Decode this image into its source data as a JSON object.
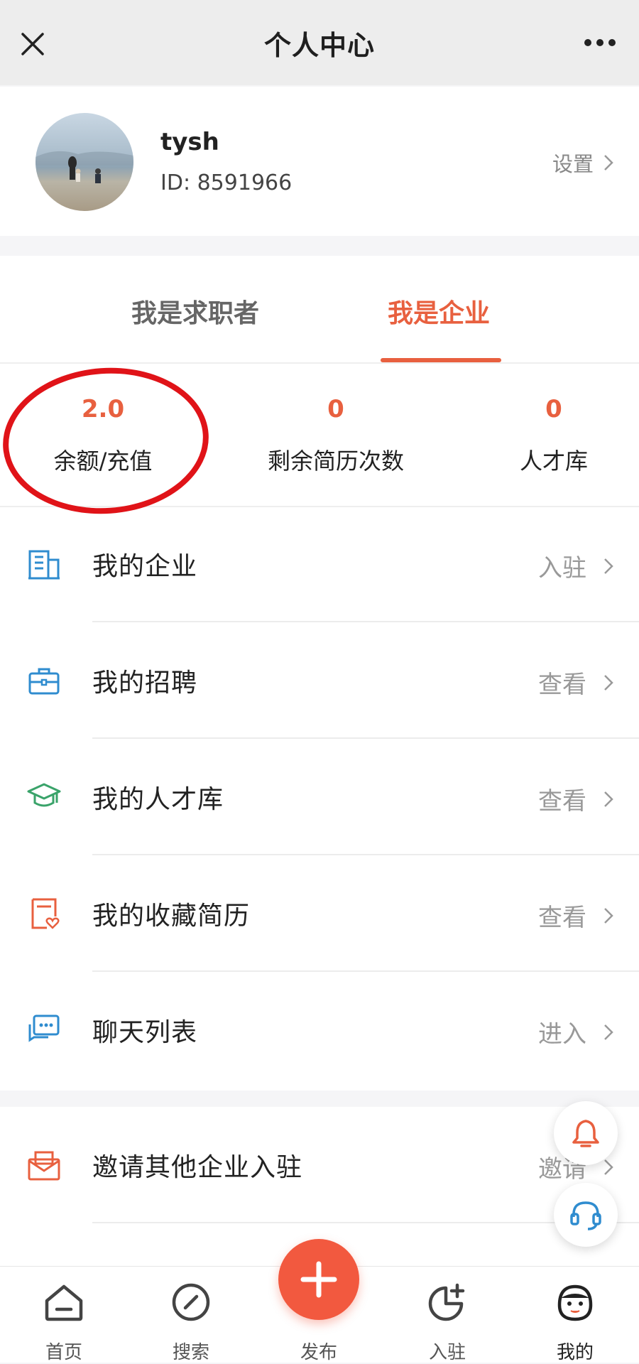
{
  "topbar": {
    "title": "个人中心",
    "close_icon": "close-icon",
    "more_icon": "more-icon"
  },
  "profile": {
    "username": "tysh",
    "id_text": "ID: 8591966",
    "settings_label": "设置"
  },
  "tabs": [
    {
      "label": "我是求职者",
      "active": false
    },
    {
      "label": "我是企业",
      "active": true
    }
  ],
  "stats": [
    {
      "value": "2.0",
      "label": "余额/充值"
    },
    {
      "value": "0",
      "label": "剩余简历次数"
    },
    {
      "value": "0",
      "label": "人才库"
    }
  ],
  "menu": [
    {
      "label": "我的企业",
      "action": "入驻",
      "icon": "building-icon"
    },
    {
      "label": "我的招聘",
      "action": "查看",
      "icon": "briefcase-icon"
    },
    {
      "label": "我的人才库",
      "action": "查看",
      "icon": "graduation-cap-icon"
    },
    {
      "label": "我的收藏简历",
      "action": "查看",
      "icon": "favorite-resume-icon"
    },
    {
      "label": "聊天列表",
      "action": "进入",
      "icon": "chat-icon"
    }
  ],
  "menu2": [
    {
      "label": "邀请其他企业入驻",
      "action": "邀请",
      "icon": "invite-envelope-icon"
    }
  ],
  "bottom_nav": [
    {
      "label": "首页",
      "icon": "home-icon"
    },
    {
      "label": "搜索",
      "icon": "compass-icon"
    },
    {
      "label": "发布",
      "icon": "plus-icon"
    },
    {
      "label": "入驻",
      "icon": "join-icon"
    },
    {
      "label": "我的",
      "icon": "mine-icon"
    }
  ],
  "colors": {
    "accent": "#e8603f",
    "publish": "#f2593f",
    "highlight_ring": "#e01318"
  }
}
